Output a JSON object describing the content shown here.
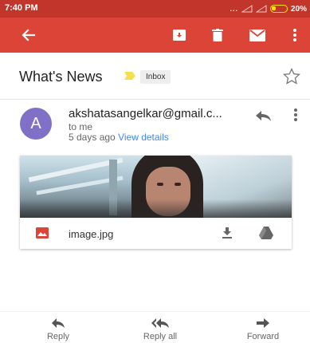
{
  "status_bar": {
    "time": "7:40 PM",
    "dots": "...",
    "battery": "20%"
  },
  "toolbar": {
    "icons": [
      "back-arrow-icon",
      "archive-icon",
      "delete-icon",
      "mail-icon",
      "more-vert-icon"
    ]
  },
  "message": {
    "subject": "What's News",
    "label": "Inbox",
    "sender": "akshatasangelkar@gmail.c...",
    "recipient": "to me",
    "time": "5 days ago",
    "view_details": "View details",
    "avatar_letter": "A"
  },
  "attachment": {
    "filename": "image.jpg"
  },
  "actions": {
    "reply": "Reply",
    "reply_all": "Reply all",
    "forward": "Forward"
  },
  "colors": {
    "status_bar": "#c1352b",
    "app_bar": "#db4437",
    "avatar": "#8070c8",
    "link": "#4285f4",
    "important_marker": "#f4e04d"
  }
}
